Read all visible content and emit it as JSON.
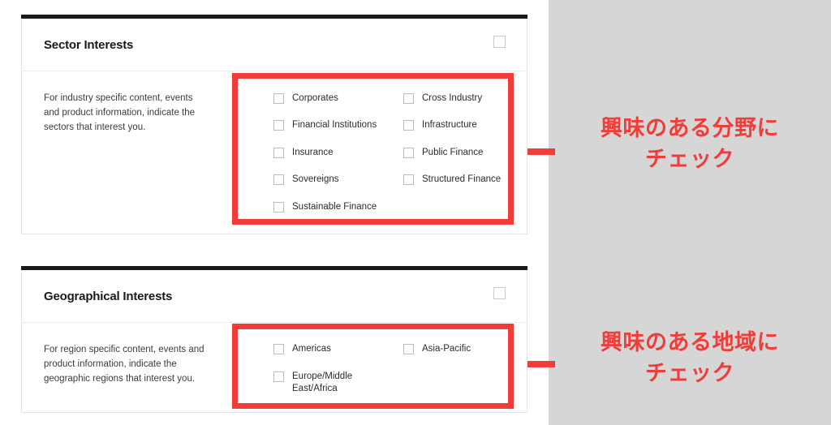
{
  "page": {
    "background_color": "#ffffff",
    "panel_color": "#d6d6d6",
    "accent_color": "#ef3e3a",
    "rule_color": "#1a1a1a"
  },
  "sector_card": {
    "title": "Sector Interests",
    "description": "For industry specific content, events and product information, indicate the sectors that interest you.",
    "header_checkbox_checked": false,
    "options": [
      {
        "label": "Corporates",
        "checked": false
      },
      {
        "label": "Cross Industry",
        "checked": false
      },
      {
        "label": "Financial Institutions",
        "checked": false
      },
      {
        "label": "Infrastructure",
        "checked": false
      },
      {
        "label": "Insurance",
        "checked": false
      },
      {
        "label": "Public Finance",
        "checked": false
      },
      {
        "label": "Sovereigns",
        "checked": false
      },
      {
        "label": "Structured Finance",
        "checked": false
      },
      {
        "label": "Sustainable Finance",
        "checked": false
      }
    ]
  },
  "geographical_card": {
    "title": "Geographical Interests",
    "description": "For region specific content, events and product information, indicate the geographic regions that interest you.",
    "header_checkbox_checked": false,
    "options": [
      {
        "label": "Americas",
        "checked": false
      },
      {
        "label": "Asia-Pacific",
        "checked": false
      },
      {
        "label": "Europe/Middle East/Africa",
        "checked": false
      }
    ]
  },
  "annotations": {
    "sector": {
      "line1": "興味のある分野に",
      "line2": "チェック"
    },
    "geographical": {
      "line1": "興味のある地域に",
      "line2": "チェック"
    }
  }
}
